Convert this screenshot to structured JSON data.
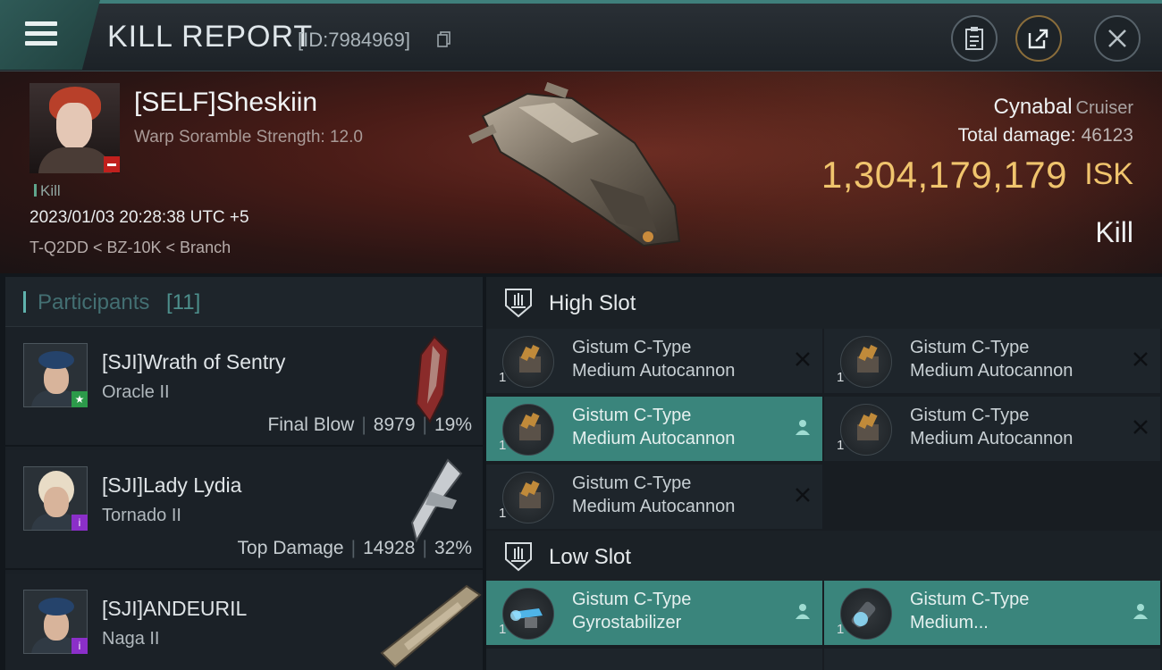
{
  "header": {
    "title": "KILL REPORT",
    "report_id": "[ID:7984969]",
    "icons": [
      "menu-icon",
      "copy-icon",
      "clipboard-icon",
      "share-icon",
      "close-icon"
    ]
  },
  "victim": {
    "name": "[SELF]Sheskiin",
    "scramble": "Warp Soramble Strength: 12.0",
    "tag": "Kill",
    "datetime": "2023/01/03 20:28:38 UTC +5",
    "location": "T-Q2DD < BZ-10K < Branch",
    "ship_name": "Cynabal",
    "ship_class": "Cruiser",
    "total_damage_label": "Total damage:",
    "total_damage": "46123",
    "isk_value": "1,304,179,179",
    "isk_unit": "ISK",
    "result": "Kill"
  },
  "participants": {
    "title": "Participants",
    "count": "[11]",
    "rows": [
      {
        "name": "[SJI]Wrath of Sentry",
        "ship": "Oracle II",
        "role": "Final Blow",
        "damage": "8979",
        "percent": "19%"
      },
      {
        "name": "[SJI]Lady Lydia",
        "ship": "Tornado II",
        "role": "Top Damage",
        "damage": "14928",
        "percent": "32%"
      },
      {
        "name": "[SJI]ANDEURIL",
        "ship": "Naga II",
        "role": "",
        "damage": "",
        "percent": ""
      }
    ]
  },
  "fitting": {
    "high_slot_title": "High Slot",
    "low_slot_title": "Low Slot",
    "high_slots": [
      {
        "line1": "Gistum C-Type",
        "line2": "Medium Autocannon",
        "qty": "1",
        "state": "destroyed"
      },
      {
        "line1": "Gistum C-Type",
        "line2": "Medium Autocannon",
        "qty": "1",
        "state": "destroyed"
      },
      {
        "line1": "Gistum C-Type",
        "line2": "Medium Autocannon",
        "qty": "1",
        "state": "dropped"
      },
      {
        "line1": "Gistum C-Type",
        "line2": "Medium Autocannon",
        "qty": "1",
        "state": "destroyed"
      },
      {
        "line1": "Gistum C-Type",
        "line2": "Medium Autocannon",
        "qty": "1",
        "state": "destroyed"
      }
    ],
    "low_slots": [
      {
        "line1": "Gistum C-Type",
        "line2": "Gyrostabilizer",
        "qty": "1",
        "state": "dropped"
      },
      {
        "line1": "Gistum C-Type",
        "line2": "Medium...",
        "qty": "1",
        "state": "dropped"
      }
    ]
  },
  "colors": {
    "accent_teal": "#3a857c",
    "isk_gold": "#f0c46d",
    "loss_red": "#c0201d"
  }
}
